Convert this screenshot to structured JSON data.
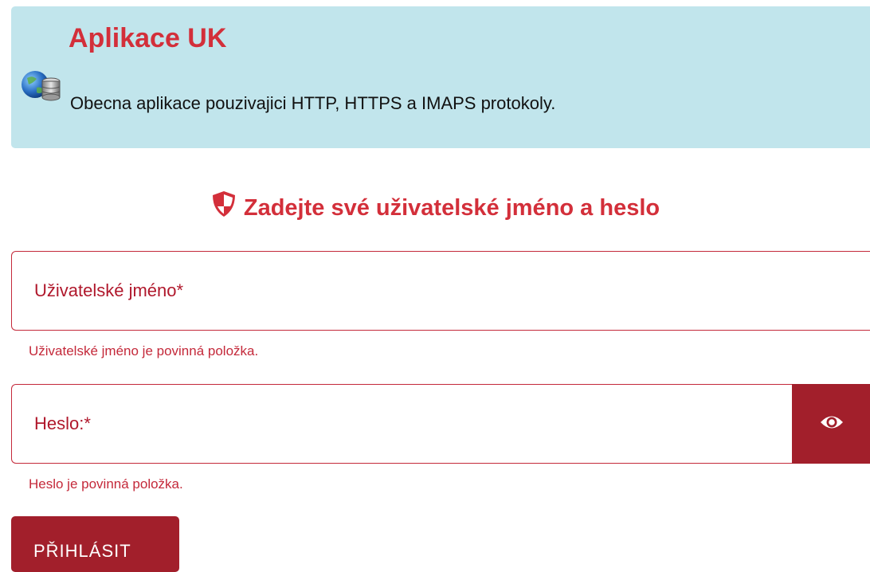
{
  "app": {
    "title": "Aplikace UK",
    "description": "Obecna aplikace pouzivajici HTTP, HTTPS a IMAPS protokoly.",
    "icon": "globe-database-icon"
  },
  "login": {
    "heading": "Zadejte své uživatelské jméno a heslo",
    "heading_icon": "shield-icon",
    "username": {
      "placeholder": "Uživatelské jméno*",
      "value": "",
      "error": "Uživatelské jméno je povinná položka."
    },
    "password": {
      "placeholder": "Heslo:*",
      "value": "",
      "error": "Heslo je povinná položka.",
      "toggle_icon": "eye-icon"
    },
    "submit_label": "PŘIHLÁSIT"
  },
  "colors": {
    "accent": "#d32f3a",
    "button": "#a21f2b",
    "banner_bg": "#c1e5ec",
    "error": "#c4293a"
  }
}
